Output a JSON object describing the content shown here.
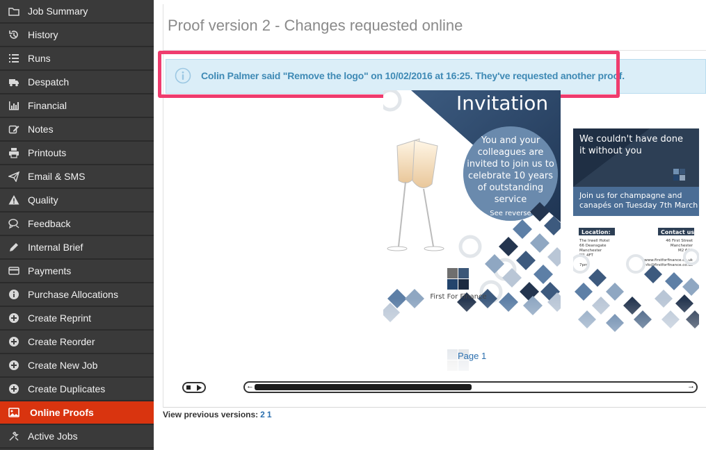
{
  "sidebar": {
    "items": [
      {
        "label": "Job Summary",
        "icon": "folder-open-icon",
        "active": false
      },
      {
        "label": "History",
        "icon": "history-icon",
        "active": false
      },
      {
        "label": "Runs",
        "icon": "list-icon",
        "active": false
      },
      {
        "label": "Despatch",
        "icon": "truck-icon",
        "active": false
      },
      {
        "label": "Financial",
        "icon": "bar-chart-icon",
        "active": false
      },
      {
        "label": "Notes",
        "icon": "edit-icon",
        "active": false
      },
      {
        "label": "Printouts",
        "icon": "printer-icon",
        "active": false
      },
      {
        "label": "Email & SMS",
        "icon": "paper-plane-icon",
        "active": false
      },
      {
        "label": "Quality",
        "icon": "warning-icon",
        "active": false
      },
      {
        "label": "Feedback",
        "icon": "comments-icon",
        "active": false
      },
      {
        "label": "Internal Brief",
        "icon": "pencil-icon",
        "active": false
      },
      {
        "label": "Payments",
        "icon": "credit-card-icon",
        "active": false
      },
      {
        "label": "Purchase Allocations",
        "icon": "info-circle-icon",
        "active": false
      },
      {
        "label": "Create Reprint",
        "icon": "plus-circle-icon",
        "active": false
      },
      {
        "label": "Create Reorder",
        "icon": "plus-circle-icon",
        "active": false
      },
      {
        "label": "Create New Job",
        "icon": "plus-circle-icon",
        "active": false
      },
      {
        "label": "Create Duplicates",
        "icon": "plus-circle-icon",
        "active": false
      },
      {
        "label": "Online Proofs",
        "icon": "image-icon",
        "active": true
      },
      {
        "label": "Active Jobs",
        "icon": "tools-icon",
        "active": false
      }
    ]
  },
  "main": {
    "title": "Proof version 2 - Changes requested online",
    "alert": "Colin Palmer said \"Remove the logo\" on 10/02/2016 at 16:25. They've requested another proof.",
    "page_label": "Page 1",
    "previous_label": "View previous versions:",
    "previous_versions": [
      "2",
      "1"
    ]
  },
  "proof": {
    "page1": {
      "heading": "Invitation",
      "circle_lines": [
        "You and your",
        "colleagues are",
        "invited to join us to",
        "celebrate 10 years",
        "of outstanding",
        "service"
      ],
      "see_reverse": "See reverse",
      "company": "First For Finance"
    },
    "page2": {
      "thanks_lines": [
        "We couldn't have done",
        "it without you"
      ],
      "join_lines": [
        "Join us for champagne and",
        "canapés on Tuesday 7th March"
      ],
      "location_label": "Location:",
      "location_lines": [
        "The Irwell Hotel",
        "66 Deansgate",
        "Manchester",
        "M1 4FT",
        "",
        "7pm"
      ],
      "contact_label": "Contact us:",
      "contact_lines": [
        "46 First Street",
        "Manchester",
        "M2 6AB",
        "",
        "www.firstforfinance.co.uk",
        "info@firstforfinance.co.uk"
      ]
    }
  },
  "colors": {
    "sidebar_bg": "#3a3a3a",
    "active_bg": "#d9340f",
    "alert_bg": "#dbeef8",
    "alert_text": "#3f8ab5",
    "highlight": "#ef3c6e",
    "navy": "#1f3553",
    "steel": "#4e78a3"
  }
}
